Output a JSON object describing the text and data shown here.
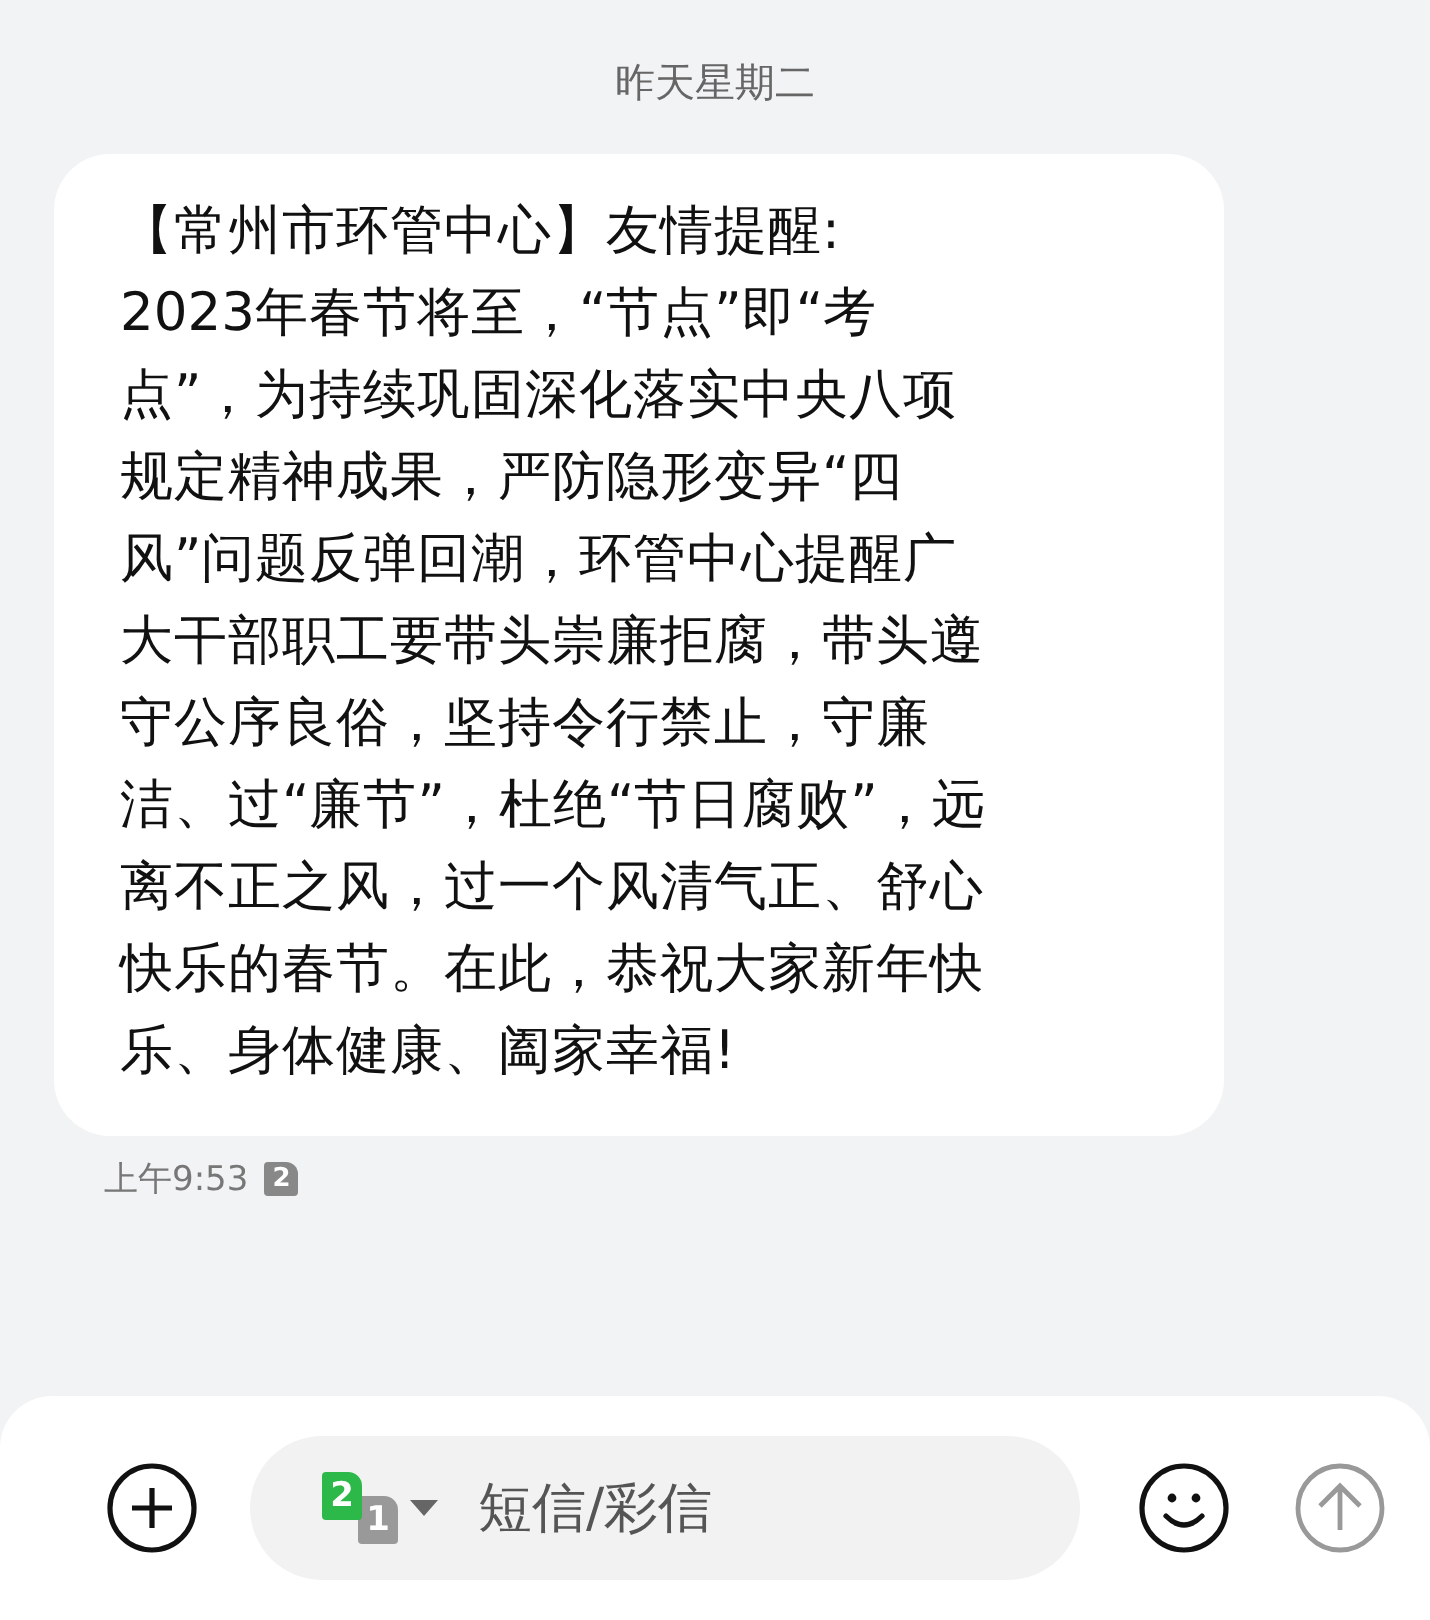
{
  "date_header": "昨天星期二",
  "message": {
    "lines": [
      "【常州市环管中心】友情提醒:",
      "2023年春节将至，“节点”即“考",
      "点”，为持续巩固深化落实中央八项",
      "规定精神成果，严防隐形变异“四",
      "风”问题反弹回潮，环管中心提醒广",
      "大干部职工要带头崇廉拒腐，带头遵",
      "守公序良俗，坚持令行禁止，守廉",
      "洁、过“廉节”，杜绝“节日腐败”，远",
      "离不正之风，过一个风清气正、舒心",
      "快乐的春节。在此，恭祝大家新年快",
      "乐、身体健康、阖家幸福!"
    ],
    "time": "上午9:53",
    "sim": "2"
  },
  "composer": {
    "sim_front": "2",
    "sim_back": "1",
    "placeholder": "短信/彩信",
    "send_disabled": true
  }
}
